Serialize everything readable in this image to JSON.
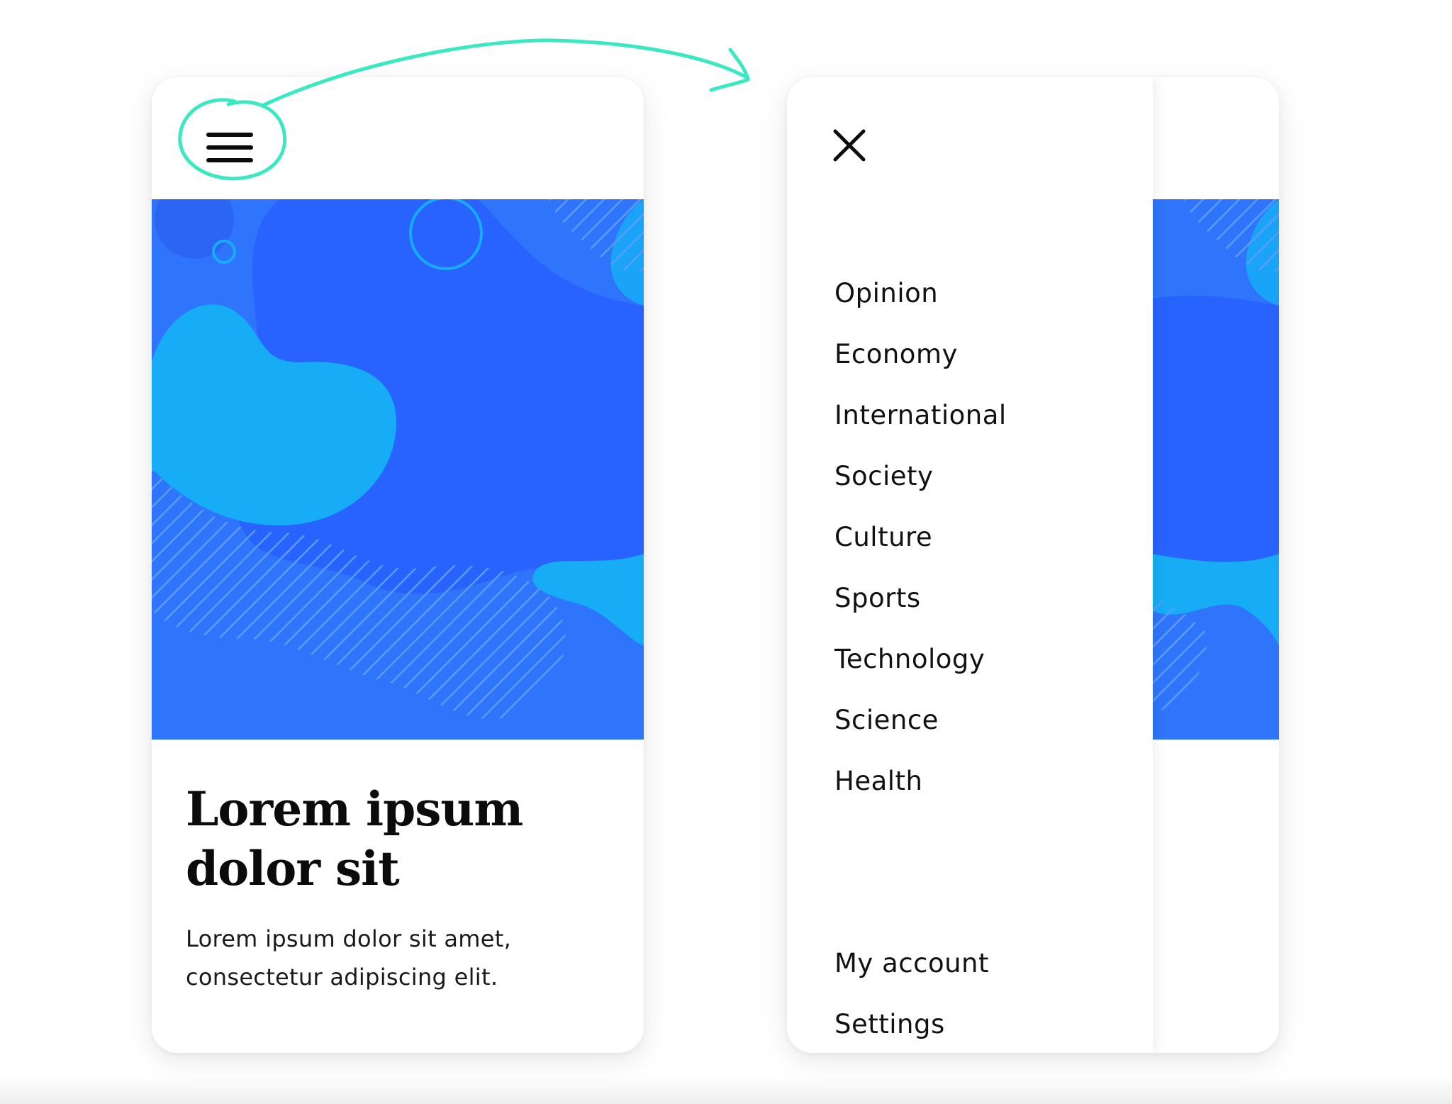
{
  "colors": {
    "accent_annotation": "#3be8c2",
    "hero_background": "#2f75fb",
    "hero_blob_dark": "#2963ff",
    "hero_blob_light": "#16adf6",
    "hero_stripes": "#5b9cfb",
    "text_primary": "#0b0b0b"
  },
  "icons": {
    "menu": "hamburger-icon",
    "close": "close-icon",
    "annotation_arrow": "curved-arrow-icon"
  },
  "screen_closed": {
    "article": {
      "title_line1": "Lorem ipsum",
      "title_line2": "dolor sit",
      "body_line1": "Lorem ipsum dolor sit amet,",
      "body_line2": "consectetur adipiscing elit."
    }
  },
  "screen_open": {
    "menu_items": [
      "Opinion",
      "Economy",
      "International",
      "Society",
      "Culture",
      "Sports",
      "Technology",
      "Science",
      "Health"
    ],
    "account_items": [
      "My account",
      "Settings"
    ]
  }
}
